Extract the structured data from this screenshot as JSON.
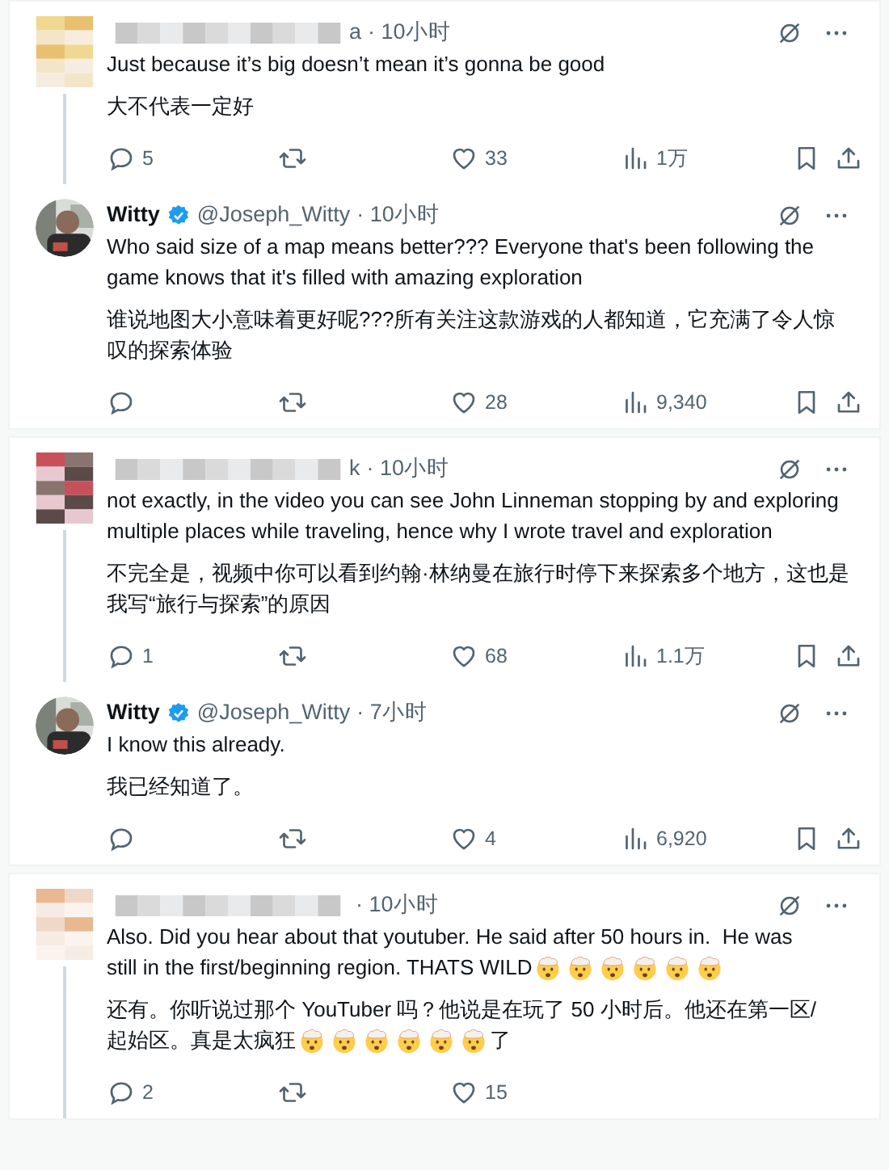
{
  "cards": [
    {
      "tweets": [
        {
          "author": {
            "kind": "anonymous",
            "name_tail": "a"
          },
          "time": "· 10小时",
          "thread_below": true,
          "paragraphs": [
            [
              {
                "kind": "text",
                "text": "Just because it’s big doesn’t mean it’s gonna be good"
              }
            ],
            [
              {
                "kind": "text",
                "text": "大不代表一定好"
              }
            ]
          ],
          "actions": [
            {
              "kind": "reply",
              "count": "5"
            },
            {
              "kind": "retweet"
            },
            {
              "kind": "like",
              "count": "33"
            },
            {
              "kind": "views",
              "count": "1万"
            },
            {
              "kind": "bookmark"
            },
            {
              "kind": "share"
            }
          ]
        },
        {
          "author": {
            "kind": "named",
            "name": "Witty",
            "verified": true,
            "handle": "@Joseph_Witty"
          },
          "time": "· 10小时",
          "thread_below": false,
          "paragraphs": [
            [
              {
                "kind": "text",
                "text": "Who said size of a map means better??? Everyone that's been following the game knows that it's filled with amazing exploration"
              }
            ],
            [
              {
                "kind": "text",
                "text": "谁说地图大小意味着更好呢???所有关注这款游戏的人都知道，它充满了令人惊叹的探索体验"
              }
            ]
          ],
          "actions": [
            {
              "kind": "reply"
            },
            {
              "kind": "retweet"
            },
            {
              "kind": "like",
              "count": "28"
            },
            {
              "kind": "views",
              "count": "9,340"
            },
            {
              "kind": "bookmark"
            },
            {
              "kind": "share"
            }
          ]
        }
      ]
    },
    {
      "tweets": [
        {
          "author": {
            "kind": "anonymous",
            "name_tail": "k"
          },
          "time": "· 10小时",
          "thread_below": true,
          "paragraphs": [
            [
              {
                "kind": "text",
                "text": "not exactly, in the video you can see John Linneman stopping by and exploring multiple places while traveling, hence why I wrote travel and exploration"
              }
            ],
            [
              {
                "kind": "text",
                "text": "不完全是，视频中你可以看到约翰·林纳曼在旅行时停下来探索多个地方，这也是我写“旅行与探索”的原因"
              }
            ]
          ],
          "actions": [
            {
              "kind": "reply",
              "count": "1"
            },
            {
              "kind": "retweet"
            },
            {
              "kind": "like",
              "count": "68"
            },
            {
              "kind": "views",
              "count": "1.1万"
            },
            {
              "kind": "bookmark"
            },
            {
              "kind": "share"
            }
          ]
        },
        {
          "author": {
            "kind": "named",
            "name": "Witty",
            "verified": true,
            "handle": "@Joseph_Witty"
          },
          "time": "· 7小时",
          "thread_below": false,
          "paragraphs": [
            [
              {
                "kind": "text",
                "text": "I know this already."
              }
            ],
            [
              {
                "kind": "text",
                "text": "我已经知道了。"
              }
            ]
          ],
          "actions": [
            {
              "kind": "reply"
            },
            {
              "kind": "retweet"
            },
            {
              "kind": "like",
              "count": "4"
            },
            {
              "kind": "views",
              "count": "6,920"
            },
            {
              "kind": "bookmark"
            },
            {
              "kind": "share"
            }
          ]
        }
      ]
    },
    {
      "tweets": [
        {
          "author": {
            "kind": "anonymous"
          },
          "time": "· 10小时",
          "thread_below": true,
          "paragraphs": [
            [
              {
                "kind": "text",
                "text": "Also. Did you hear about that youtuber. He said after 50 hours in.  He was"
              },
              {
                "kind": "text",
                "text": "still in the first/beginning region. THATS WILD"
              },
              {
                "kind": "emoji"
              },
              {
                "kind": "emoji"
              },
              {
                "kind": "emoji"
              },
              {
                "kind": "emoji"
              },
              {
                "kind": "emoji"
              },
              {
                "kind": "emoji"
              }
            ],
            [
              {
                "kind": "text",
                "text": "还有。你听说过那个 YouTuber 吗？他说是在玩了 50 小时后。他还在第一区/"
              },
              {
                "kind": "text",
                "text": "起始区。真是太疯狂"
              },
              {
                "kind": "emoji"
              },
              {
                "kind": "emoji"
              },
              {
                "kind": "emoji"
              },
              {
                "kind": "emoji"
              },
              {
                "kind": "emoji"
              },
              {
                "kind": "emoji"
              },
              {
                "kind": "text",
                "text": "了"
              }
            ]
          ],
          "actions": [
            {
              "kind": "reply",
              "count": "2"
            },
            {
              "kind": "retweet"
            },
            {
              "kind": "like",
              "count": "15"
            }
          ]
        }
      ]
    }
  ]
}
